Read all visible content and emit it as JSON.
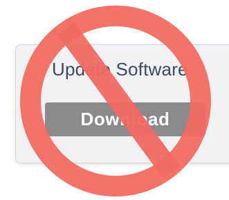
{
  "dialog": {
    "title": "Update Software",
    "button_label": "Download"
  },
  "overlay": {
    "icon": "prohibition-sign-icon",
    "color": "#f26b63"
  },
  "colors": {
    "dialog_background": "#f1f1f3",
    "title_text": "#3c4a60",
    "button_background": "#8b8b8d",
    "button_text": "#ffffff"
  }
}
